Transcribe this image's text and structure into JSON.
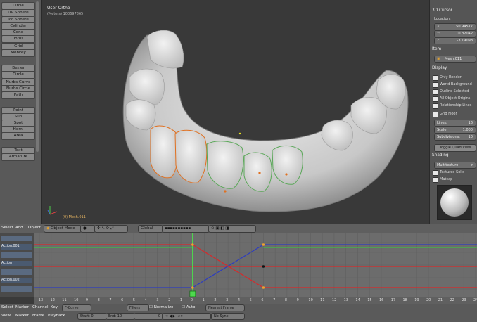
{
  "left_toolbar": {
    "buttons": [
      "Circle",
      "UV Sphere",
      "Ico Sphere",
      "Cylinder",
      "Cone",
      "Torus",
      "Grid",
      "Monkey",
      "Bezier",
      "Circle",
      "Nurbs Curve",
      "Nurbs Circle",
      "Path",
      "Point",
      "Sun",
      "Spot",
      "Hemi",
      "Area",
      "Text",
      "Armature"
    ]
  },
  "viewport": {
    "title": "User Ortho",
    "subtitle": "(Meters) 100697865",
    "object_label": "(0) Mesh.011"
  },
  "right_panel": {
    "cursor_section": "3D Cursor",
    "location_label": "Location:",
    "location": [
      {
        "k": "X:",
        "v": "50.94577"
      },
      {
        "k": "Y:",
        "v": "10.32042"
      },
      {
        "k": "Z:",
        "v": "-3.19098"
      }
    ],
    "item_section": "Item",
    "item_name": "Mesh.011",
    "display_section": "Display",
    "checks": [
      "Only Render",
      "World Background",
      "Outline Selected",
      "All Object Origins",
      "Relationship Lines",
      "Grid Floor"
    ],
    "lines_label": "Lines:",
    "lines_value": "16",
    "scale_label": "Scale:",
    "scale_value": "1.000",
    "subdiv_label": "Subdivisions:",
    "subdiv_value": "10",
    "quad_button": "Toggle Quad View",
    "shading_section": "Shading",
    "shading_mode": "Multitexture",
    "textured_solid": "Textured Solid",
    "matcap": "Matcap"
  },
  "view_header": {
    "menus": [
      "Select",
      "Add",
      "Object"
    ],
    "mode": "Object Mode",
    "orientation": "Global"
  },
  "timeline_left": {
    "rows": [
      "",
      "Action.001",
      "",
      "Action",
      "",
      "Action.002",
      ""
    ]
  },
  "timeline_ticks": [
    "-13",
    "-12",
    "-11",
    "-10",
    "-9",
    "-8",
    "-7",
    "-6",
    "-5",
    "-4",
    "-3",
    "-2",
    "-1",
    "0",
    "1",
    "2",
    "3",
    "4",
    "5",
    "6",
    "7",
    "8",
    "9",
    "10",
    "11",
    "12",
    "13",
    "14",
    "15",
    "16",
    "17",
    "18",
    "19",
    "20",
    "21",
    "22",
    "23",
    "24"
  ],
  "current_frame_marker": "0",
  "footer": {
    "menus_row1": [
      "Select",
      "Marker",
      "Channel",
      "Key"
    ],
    "fcurve": "F-Curve",
    "filters": "Filters",
    "normalize": "Normalize",
    "auto": "Auto",
    "nearest_frame": "Nearest Frame",
    "menus_row2": [
      "View",
      "Marker",
      "Frame",
      "Playback"
    ],
    "start_label": "Start:",
    "start_value": "0",
    "end_label": "End:",
    "end_value": "10",
    "current_value": "0",
    "sync": "No Sync"
  },
  "colors": {
    "curve_red": "#d8282a",
    "curve_blue": "#2c3cc0",
    "curve_green": "#3ec046",
    "playhead": "#4ed84e",
    "keyframe_orange": "#f0a030"
  }
}
